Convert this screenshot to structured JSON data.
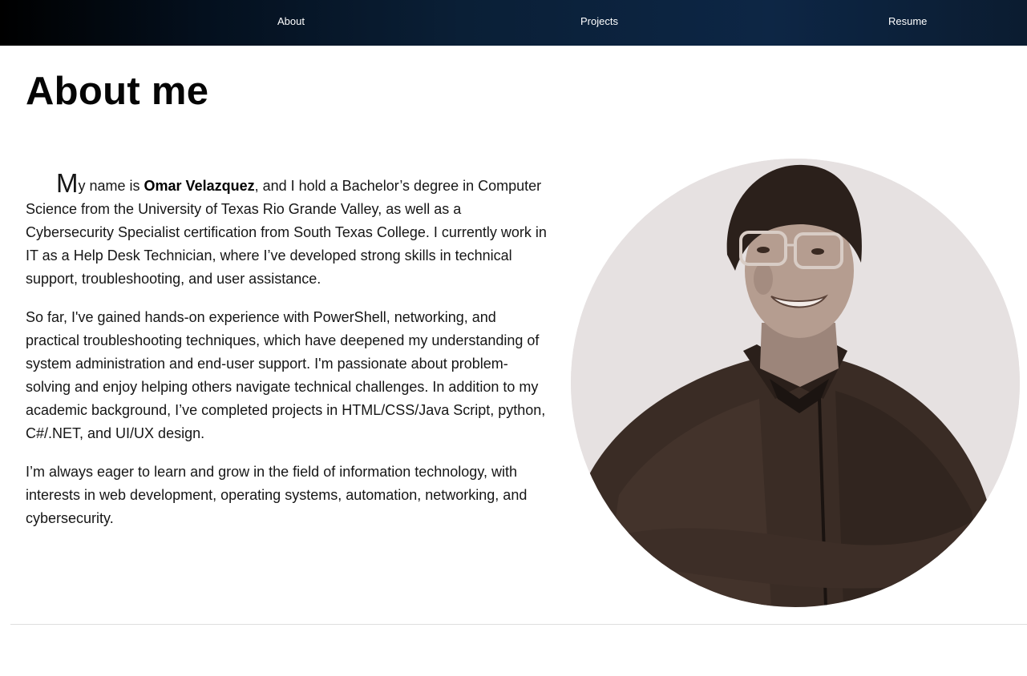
{
  "nav": {
    "about": "About",
    "projects": "Projects",
    "resume": "Resume"
  },
  "page": {
    "title": "About me"
  },
  "about": {
    "p1_dropcap": "M",
    "p1_lead": "y name is ",
    "p1_name": "Omar Velazquez",
    "p1_rest": ", and I hold a Bachelor’s degree in Computer Science from the University of Texas Rio Grande Valley, as well as a Cybersecurity Specialist certification from South Texas College. I currently work in IT as a Help Desk Technician, where I’ve developed strong skills in technical support, troubleshooting, and user assistance.",
    "p2": "So far, I've gained hands-on experience with PowerShell, networking, and practical troubleshooting techniques, which have deepened my understanding of system administration and end-user support. I'm passionate about problem-solving and enjoy helping others navigate technical challenges. In addition to my academic background, I’ve completed projects in HTML/CSS/Java Script, python, C#/.NET, and UI/UX design.",
    "p3": "I’m always eager to learn and grow in the field of information technology, with interests in web development, operating systems, automation, networking, and cybersecurity."
  },
  "colors": {
    "nav_start": "#000000",
    "nav_end": "#0d2645",
    "portrait_bg": "#e6e1e1",
    "sepia_dark": "#2a1f1a"
  }
}
